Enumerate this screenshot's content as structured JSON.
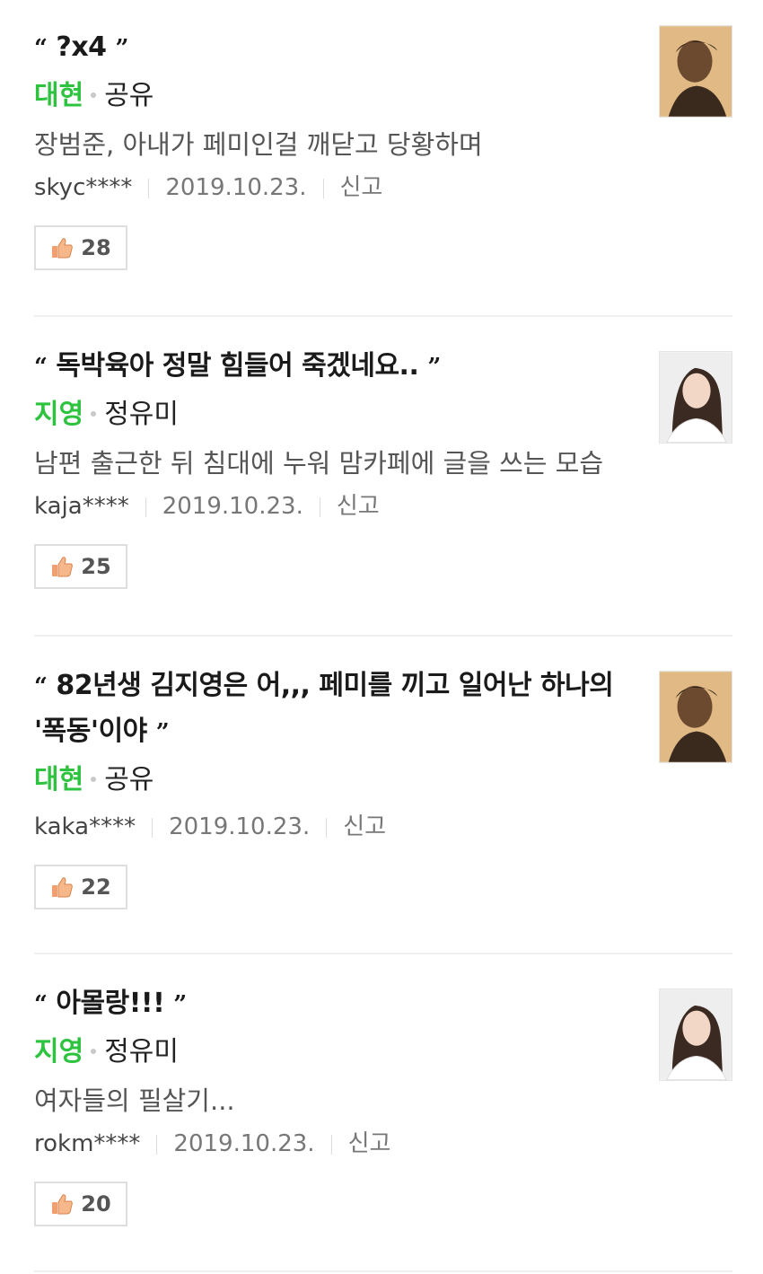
{
  "comments": [
    {
      "quote": "?x4",
      "character": "대현",
      "actor": "공유",
      "description": "장범준, 아내가 페미인걸 깨닫고 당황하며",
      "user": "skyc****",
      "date": "2019.10.23.",
      "report_label": "신고",
      "likes": "28",
      "avatar": "male-actor-photo"
    },
    {
      "quote": "독박육아 정말 힘들어 죽겠네요..",
      "character": "지영",
      "actor": "정유미",
      "description": "남편 출근한 뒤 침대에 누워 맘카페에 글을 쓰는 모습",
      "user": "kaja****",
      "date": "2019.10.23.",
      "report_label": "신고",
      "likes": "25",
      "avatar": "female-actor-photo"
    },
    {
      "quote": "82년생 김지영은 어,,, 페미를 끼고 일어난 하나의 '폭동'이야",
      "character": "대현",
      "actor": "공유",
      "description": "",
      "user": "kaka****",
      "date": "2019.10.23.",
      "report_label": "신고",
      "likes": "22",
      "avatar": "male-actor-photo"
    },
    {
      "quote": "아몰랑!!!",
      "character": "지영",
      "actor": "정유미",
      "description": "여자들의 필살기...",
      "user": "rokm****",
      "date": "2019.10.23.",
      "report_label": "신고",
      "likes": "20",
      "avatar": "female-actor-photo"
    }
  ],
  "colors": {
    "character": "#2ec33e",
    "divider": "#efefef"
  }
}
